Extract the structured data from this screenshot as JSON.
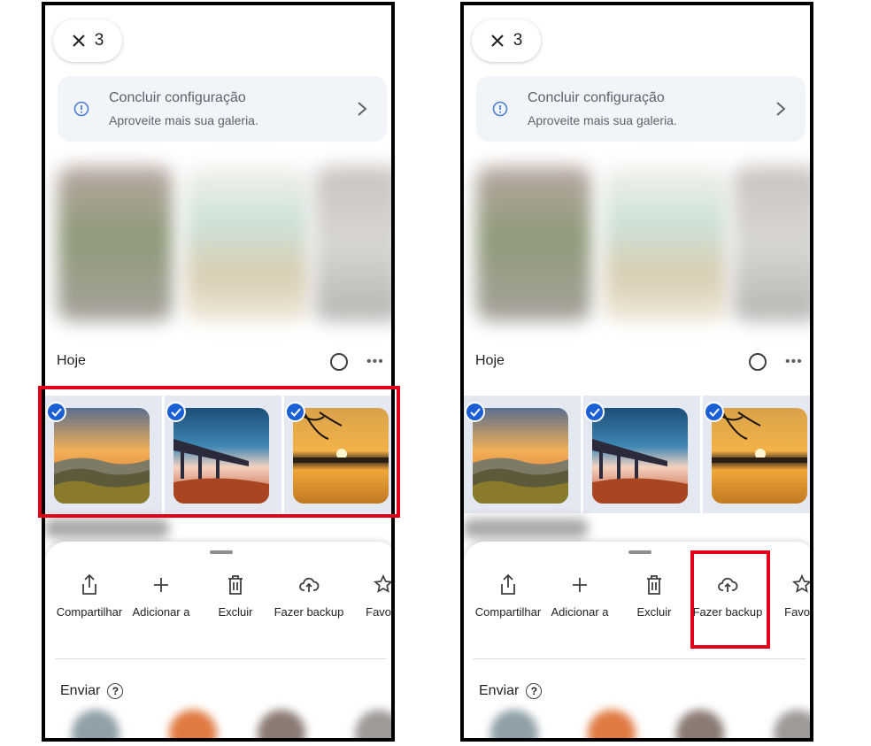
{
  "screens": [
    {
      "selection_count": "3",
      "banner": {
        "title": "Concluir configuração",
        "subtitle": "Aproveite mais sua galeria."
      },
      "section_title": "Hoje",
      "more_label": "•••",
      "actions": [
        {
          "label": "Compartilhar",
          "icon": "share-icon"
        },
        {
          "label": "Adicionar a",
          "icon": "plus-icon"
        },
        {
          "label": "Excluir",
          "icon": "trash-icon"
        },
        {
          "label": "Fazer backup",
          "icon": "cloud-upload-icon"
        },
        {
          "label": "Favorit",
          "icon": "star-icon"
        }
      ],
      "send_label": "Enviar",
      "help_label": "?"
    },
    {
      "selection_count": "3",
      "banner": {
        "title": "Concluir configuração",
        "subtitle": "Aproveite mais sua galeria."
      },
      "section_title": "Hoje",
      "more_label": "•••",
      "actions": [
        {
          "label": "Compartilhar",
          "icon": "share-icon"
        },
        {
          "label": "Adicionar a",
          "icon": "plus-icon"
        },
        {
          "label": "Excluir",
          "icon": "trash-icon"
        },
        {
          "label": "Fazer backup",
          "icon": "cloud-upload-icon"
        },
        {
          "label": "Favorit",
          "icon": "star-icon"
        }
      ],
      "send_label": "Enviar",
      "help_label": "?"
    }
  ],
  "colors": {
    "highlight": "#e3001b",
    "check": "#1a5fd4",
    "banner_bg": "#f1f4f9",
    "selected_bg": "#e4e8f1"
  }
}
